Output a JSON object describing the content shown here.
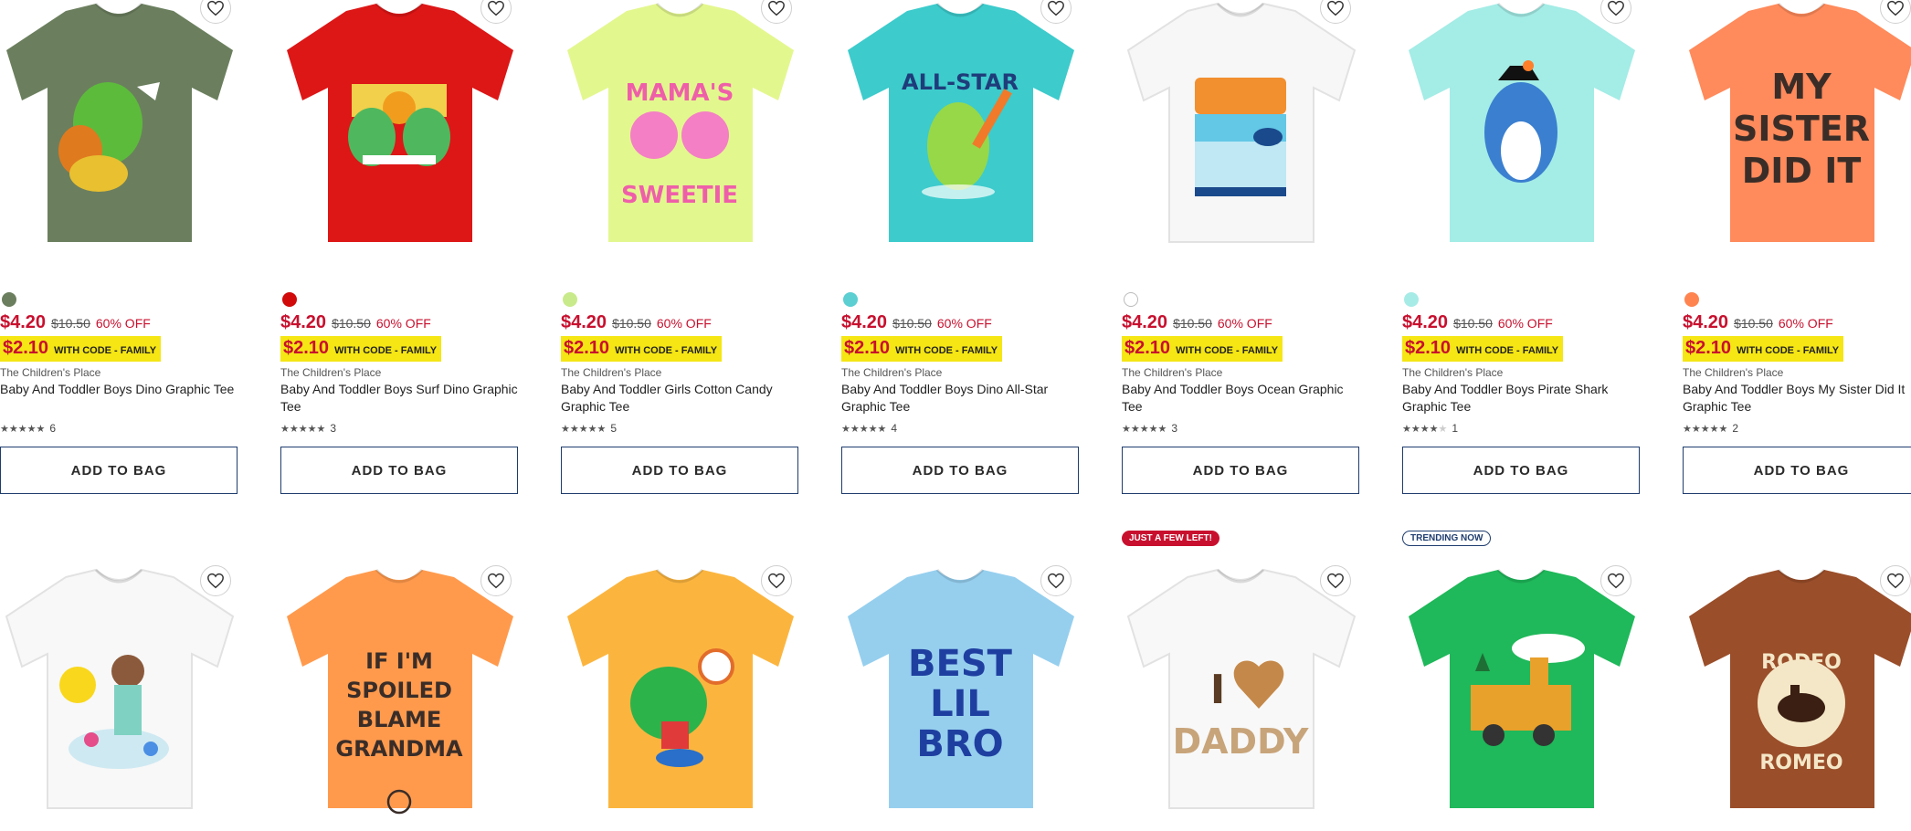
{
  "colors": {
    "sale_red": "#c8102e",
    "promo_yellow": "#f5e614",
    "button_border": "#1e3c6e"
  },
  "products_row1": [
    {
      "shirt_color": "#6b7f5e",
      "graphic": "dinosaurs",
      "swatch": "#6b7f5e",
      "sale_price": "$4.20",
      "orig_price": "$10.50",
      "discount": "60% OFF",
      "code_price": "$2.10",
      "code_text": "WITH CODE - FAMILY",
      "brand": "The Children's Place",
      "name": "Baby And Toddler Boys Dino Graphic Tee",
      "stars": 5,
      "reviews": "6",
      "button": "ADD TO BAG"
    },
    {
      "shirt_color": "#dd1616",
      "graphic": "surf-dinos",
      "swatch": "#d10a0a",
      "sale_price": "$4.20",
      "orig_price": "$10.50",
      "discount": "60% OFF",
      "code_price": "$2.10",
      "code_text": "WITH CODE - FAMILY",
      "brand": "The Children's Place",
      "name": "Baby And Toddler Boys Surf Dino Graphic Tee",
      "stars": 4.5,
      "reviews": "3",
      "button": "ADD TO BAG"
    },
    {
      "shirt_color": "#e3f78f",
      "graphic": "cotton-candy",
      "swatch": "#c9ea8a",
      "sale_price": "$4.20",
      "orig_price": "$10.50",
      "discount": "60% OFF",
      "code_price": "$2.10",
      "code_text": "WITH CODE - FAMILY",
      "brand": "The Children's Place",
      "name": "Baby And Toddler Girls Cotton Candy Graphic Tee",
      "stars": 5,
      "reviews": "5",
      "button": "ADD TO BAG",
      "shirt_text": [
        "MAMA'S",
        "SWEETIE"
      ]
    },
    {
      "shirt_color": "#3dcbcc",
      "graphic": "allstar-dino",
      "swatch": "#5bcfd2",
      "sale_price": "$4.20",
      "orig_price": "$10.50",
      "discount": "60% OFF",
      "code_price": "$2.10",
      "code_text": "WITH CODE - FAMILY",
      "brand": "The Children's Place",
      "name": "Baby And Toddler Boys Dino All-Star Graphic Tee",
      "stars": 5,
      "reviews": "4",
      "button": "ADD TO BAG",
      "shirt_text": [
        "ALL-STAR"
      ]
    },
    {
      "shirt_color": "#f7f7f7",
      "graphic": "ocean",
      "swatch": "#ffffff",
      "sale_price": "$4.20",
      "orig_price": "$10.50",
      "discount": "60% OFF",
      "code_price": "$2.10",
      "code_text": "WITH CODE - FAMILY",
      "brand": "The Children's Place",
      "name": "Baby And Toddler Boys Ocean Graphic Tee",
      "stars": 5,
      "reviews": "3",
      "button": "ADD TO BAG"
    },
    {
      "shirt_color": "#a4ece6",
      "graphic": "pirate-shark",
      "swatch": "#a7ebe6",
      "sale_price": "$4.20",
      "orig_price": "$10.50",
      "discount": "60% OFF",
      "code_price": "$2.10",
      "code_text": "WITH CODE - FAMILY",
      "brand": "The Children's Place",
      "name": "Baby And Toddler Boys Pirate Shark Graphic Tee",
      "stars": 4,
      "reviews": "1",
      "button": "ADD TO BAG"
    },
    {
      "shirt_color": "#ff8a5b",
      "graphic": "text",
      "swatch": "#ff8450",
      "sale_price": "$4.20",
      "orig_price": "$10.50",
      "discount": "60% OFF",
      "code_price": "$2.10",
      "code_text": "WITH CODE - FAMILY",
      "brand": "The Children's Place",
      "name": "Baby And Toddler Boys My Sister Did It Graphic Tee",
      "stars": 5,
      "reviews": "2",
      "button": "ADD TO BAG",
      "shirt_text": [
        "MY",
        "SISTER",
        "DID IT"
      ]
    }
  ],
  "products_row2": [
    {
      "shirt_color": "#f8f8f8",
      "graphic": "painter-girl"
    },
    {
      "shirt_color": "#ff9a4d",
      "graphic": "text",
      "shirt_text": [
        "IF I'M",
        "SPOILED",
        "BLAME",
        "GRANDMA"
      ]
    },
    {
      "shirt_color": "#fbb53f",
      "graphic": "basketball-dino"
    },
    {
      "shirt_color": "#96cfee",
      "graphic": "text",
      "shirt_text": [
        "BEST",
        "LIL",
        "BRO"
      ]
    },
    {
      "shirt_color": "#f8f8f8",
      "graphic": "i-heart-daddy",
      "badge": "JUST A FEW LEFT!",
      "badge_style": "red",
      "shirt_text": [
        "I",
        "DADDY"
      ]
    },
    {
      "shirt_color": "#1fb85a",
      "graphic": "train",
      "badge": "TRENDING NOW",
      "badge_style": "outline"
    },
    {
      "shirt_color": "#9a4e2a",
      "graphic": "rodeo",
      "shirt_text": [
        "RODEO",
        "ROMEO"
      ]
    }
  ]
}
